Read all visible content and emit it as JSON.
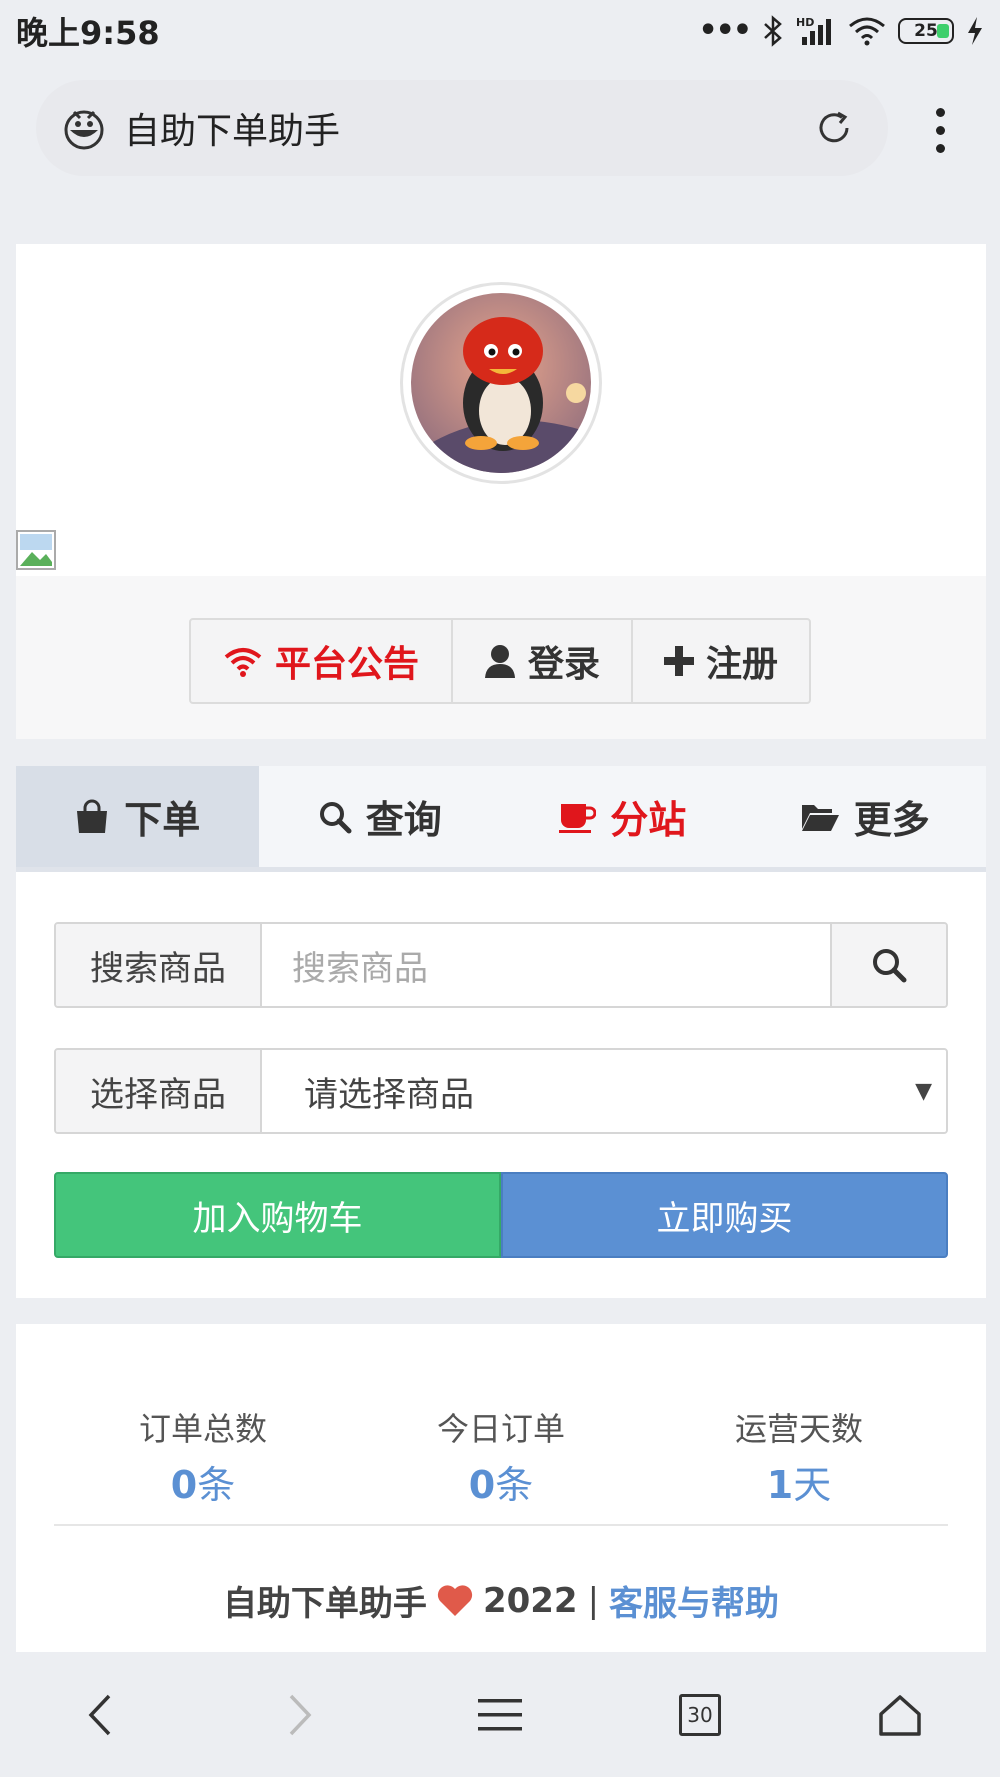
{
  "status_bar": {
    "time": "晚上9:58",
    "battery": "25"
  },
  "browser": {
    "site_title": "自助下单助手"
  },
  "header": {
    "buttons": {
      "notice": "平台公告",
      "login": "登录",
      "register": "注册"
    }
  },
  "tabs": [
    {
      "label": "下单",
      "icon": "shopping-bag-icon"
    },
    {
      "label": "查询",
      "icon": "search-icon"
    },
    {
      "label": "分站",
      "icon": "coffee-cup-icon"
    },
    {
      "label": "更多",
      "icon": "folder-open-icon"
    }
  ],
  "form": {
    "search_label": "搜索商品",
    "search_placeholder": "搜索商品",
    "select_label": "选择商品",
    "select_value": "请选择商品",
    "add_cart": "加入购物车",
    "buy_now": "立即购买"
  },
  "stats": [
    {
      "label": "订单总数",
      "value": "0",
      "unit": "条"
    },
    {
      "label": "今日订单",
      "value": "0",
      "unit": "条"
    },
    {
      "label": "运营天数",
      "value": "1",
      "unit": "天"
    }
  ],
  "footer": {
    "brand": "自助下单助手",
    "year": "2022",
    "separator": "|",
    "help_link": "客服与帮助"
  },
  "bottom_nav": {
    "tab_count": "30"
  },
  "colors": {
    "red": "#e0161c",
    "green": "#44c57b",
    "blue": "#5b90d3"
  }
}
